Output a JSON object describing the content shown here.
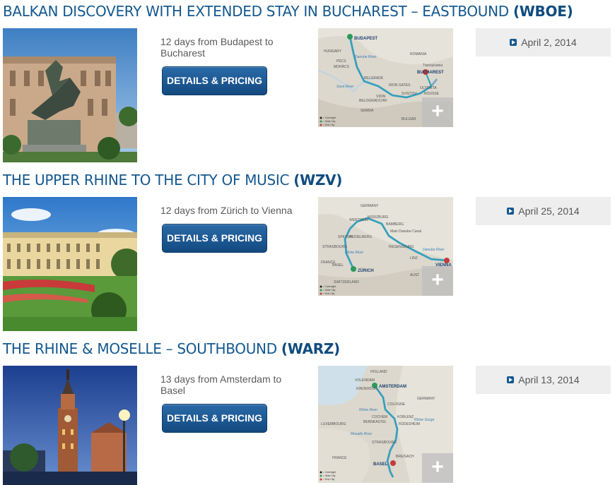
{
  "cruises": [
    {
      "title": "Balkan Discovery with Extended Stay in Bucharest – Eastbound",
      "code": "(WBOE)",
      "description": "12 days from Budapest to Bucharest",
      "button_label": "DETAILS & PRICING",
      "date": "April 2, 2014",
      "map_labels": {
        "start": "BUDAPEST",
        "end": "BUCHAREST",
        "c1": "HUNGARY",
        "c2": "ROMANIA",
        "c3": "SERBIA",
        "c4": "BULGAR",
        "r1": "Danube River",
        "r2": "Sava River",
        "t1": "PÉCS",
        "t2": "MOHÁCS",
        "t3": "BELGRADE",
        "t4": "IRON GATES",
        "t5": "VIDIN",
        "t6": "BELOGRADCHIK",
        "t7": "OLTENITA",
        "t8": "SVISTOV",
        "t9": "ROUSSE",
        "t10": "Transylvania",
        "legend1": "= Overnight",
        "legend2": "= Start City",
        "legend3": "= End City"
      }
    },
    {
      "title": "The Upper Rhine to the City of Music",
      "code": "(WZV)",
      "description": "12 days from Zürich to Vienna",
      "button_label": "DETAILS & PRICING",
      "date": "April 25, 2014",
      "map_labels": {
        "start": "ZÜRICH",
        "end": "VIENNA",
        "c1": "GERMANY",
        "c2": "FRANCE",
        "c3": "SWITZERLAND",
        "c4": "AUST",
        "r1": "Rhine River",
        "r2": "Danube River",
        "t1": "WERTHEIM",
        "t2": "WÜRZBURG",
        "t3": "BAMBERG",
        "t4": "SPEYER",
        "t5": "HEIDELBERG",
        "t6": "STRASBOURG",
        "t7": "BASEL",
        "t8": "REGENSBURG",
        "t9": "LINZ",
        "t10": "Main Danube Canal",
        "legend1": "= Overnight",
        "legend2": "= Start City",
        "legend3": "= End City"
      }
    },
    {
      "title": "The Rhine & Moselle – Southbound",
      "code": "(WARZ)",
      "description": "13 days from Amsterdam to Basel",
      "button_label": "DETAILS & PRICING",
      "date": "April 13, 2014",
      "map_labels": {
        "start": "AMSTERDAM",
        "end": "BASEL",
        "c1": "HOLLAND",
        "c2": "GERMANY",
        "c3": "LUXEMBOURG",
        "c4": "FRANCE",
        "r1": "Rhine River",
        "r2": "Moselle River",
        "t1": "VOLENDAM",
        "t2": "KINDERDIJK",
        "t3": "COLOGNE",
        "t4": "KOBLENZ",
        "t5": "COCHEM",
        "t6": "BERNKASTEL",
        "t7": "STRASBOURG",
        "t8": "BREISACH",
        "t9": "RÜDESHEIM",
        "t10": "Rhine Gorge",
        "legend1": "= Overnight",
        "legend2": "= Start City",
        "legend3": "= End City"
      }
    }
  ]
}
